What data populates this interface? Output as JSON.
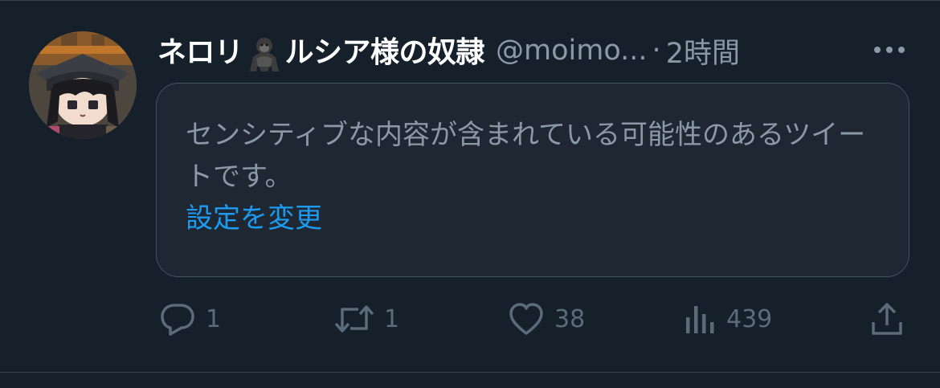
{
  "tweet": {
    "display_name_prefix": "ネロリ",
    "display_name_suffix": "ルシア様の奴隷",
    "name_emoji": "gorilla-icon",
    "handle": "@moimo...",
    "separator": "·",
    "time": "2時間",
    "more_icon": "more-icon"
  },
  "sensitive_notice": {
    "text": "センシティブな内容が含まれている可能性のあるツイートです。",
    "settings_link": "設定を変更"
  },
  "actions": {
    "reply_count": "1",
    "retweet_count": "1",
    "like_count": "38",
    "view_count": "439"
  },
  "colors": {
    "background": "#15202b",
    "card_background": "#1e2732",
    "link": "#1d9bf0",
    "muted_text": "#8b98a5",
    "icon": "#5c6b79"
  }
}
